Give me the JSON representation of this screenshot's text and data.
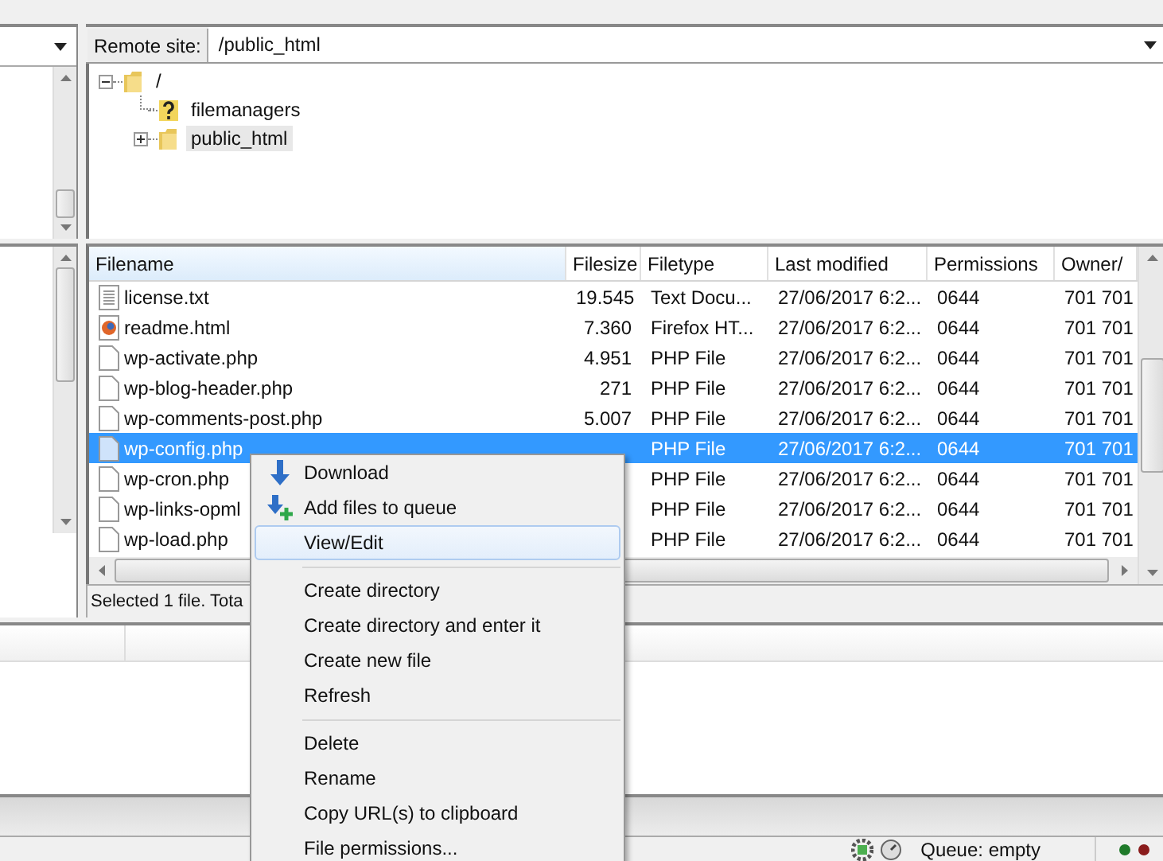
{
  "remote_site": {
    "label": "Remote site:",
    "value": "/public_html"
  },
  "remote_tree": [
    {
      "label": "/",
      "kind": "folder",
      "expanded": true,
      "selected": false,
      "children": [
        {
          "label": "filemanagers",
          "kind": "unknown",
          "selected": false
        },
        {
          "label": "public_html",
          "kind": "folder",
          "expanded": false,
          "selected": true
        }
      ]
    }
  ],
  "file_list": {
    "columns": [
      "Filename",
      "Filesize",
      "Filetype",
      "Last modified",
      "Permissions",
      "Owner/"
    ],
    "rows": [
      {
        "kind": "text",
        "name": "license.txt",
        "size": "19.545",
        "type": "Text Docu...",
        "modified": "27/06/2017 6:2...",
        "permissions": "0644",
        "owner": "701 701",
        "selected": false
      },
      {
        "kind": "html",
        "name": "readme.html",
        "size": "7.360",
        "type": "Firefox HT...",
        "modified": "27/06/2017 6:2...",
        "permissions": "0644",
        "owner": "701 701",
        "selected": false
      },
      {
        "kind": "php",
        "name": "wp-activate.php",
        "size": "4.951",
        "type": "PHP File",
        "modified": "27/06/2017 6:2...",
        "permissions": "0644",
        "owner": "701 701",
        "selected": false
      },
      {
        "kind": "php",
        "name": "wp-blog-header.php",
        "size": "271",
        "type": "PHP File",
        "modified": "27/06/2017 6:2...",
        "permissions": "0644",
        "owner": "701 701",
        "selected": false
      },
      {
        "kind": "php",
        "name": "wp-comments-post.php",
        "size": "5.007",
        "type": "PHP File",
        "modified": "27/06/2017 6:2...",
        "permissions": "0644",
        "owner": "701 701",
        "selected": false
      },
      {
        "kind": "php",
        "name": "wp-config.php",
        "type": "PHP File",
        "modified": "27/06/2017 6:2...",
        "permissions": "0644",
        "owner": "701 701",
        "selected": true
      },
      {
        "kind": "php",
        "name": "wp-cron.php",
        "type": "PHP File",
        "modified": "27/06/2017 6:2...",
        "permissions": "0644",
        "owner": "701 701",
        "selected": false
      },
      {
        "kind": "php",
        "name": "wp-links-opml",
        "type": "PHP File",
        "modified": "27/06/2017 6:2...",
        "permissions": "0644",
        "owner": "701 701",
        "selected": false
      },
      {
        "kind": "php",
        "name": "wp-load.php",
        "type": "PHP File",
        "modified": "27/06/2017 6:2...",
        "permissions": "0644",
        "owner": "701 701",
        "selected": false
      }
    ],
    "status": "Selected 1 file. Tota"
  },
  "context_menu": {
    "groups": [
      [
        {
          "label": "Download",
          "kind": "download",
          "selected": false
        },
        {
          "label": "Add files to queue",
          "kind": "enqueue",
          "selected": false
        },
        {
          "label": "View/Edit",
          "kind": "plain",
          "selected": true
        }
      ],
      [
        {
          "label": "Create directory",
          "kind": "plain",
          "selected": false
        },
        {
          "label": "Create directory and enter it",
          "kind": "plain",
          "selected": false
        },
        {
          "label": "Create new file",
          "kind": "plain",
          "selected": false
        },
        {
          "label": "Refresh",
          "kind": "plain",
          "selected": false
        }
      ],
      [
        {
          "label": "Delete",
          "kind": "plain",
          "selected": false
        },
        {
          "label": "Rename",
          "kind": "plain",
          "selected": false
        },
        {
          "label": "Copy URL(s) to clipboard",
          "kind": "plain",
          "selected": false
        },
        {
          "label": "File permissions...",
          "kind": "plain",
          "selected": false
        }
      ]
    ]
  },
  "status_bar": {
    "queue": "Queue: empty"
  }
}
